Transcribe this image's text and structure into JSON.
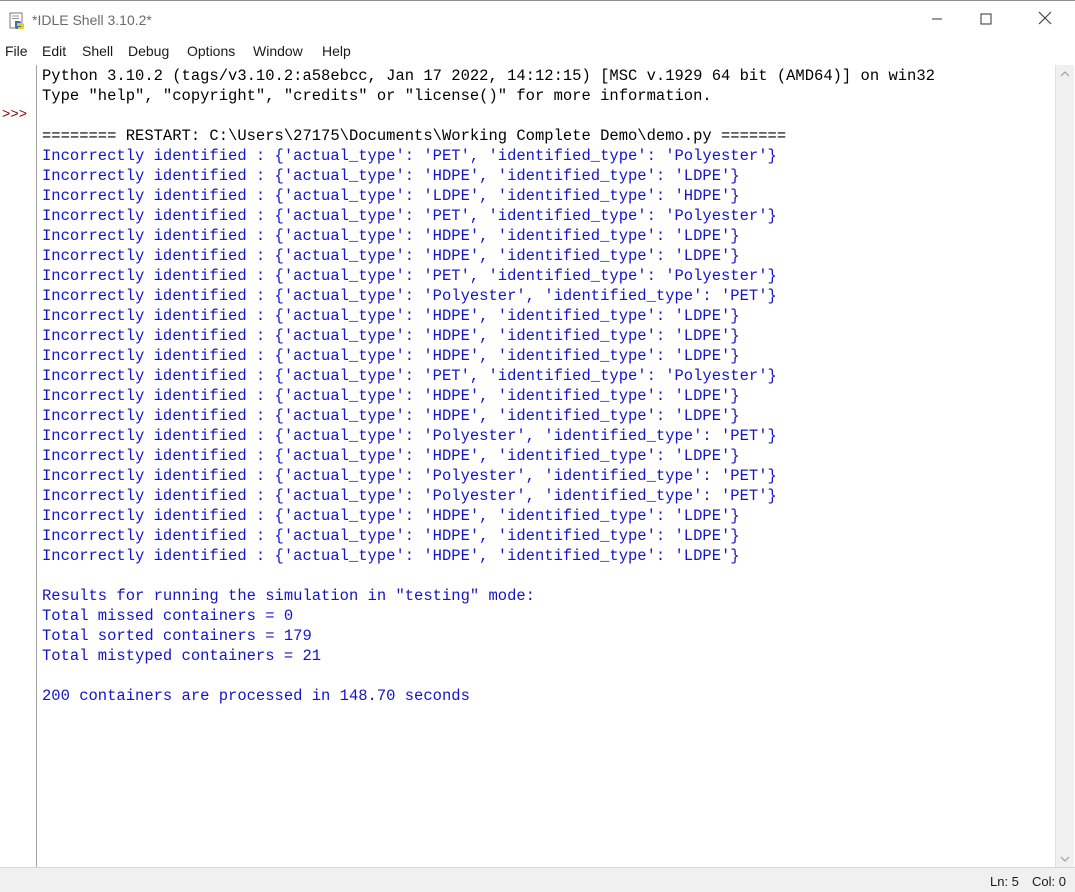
{
  "window": {
    "title": "*IDLE Shell 3.10.2*"
  },
  "menu": {
    "items": [
      {
        "label": "File"
      },
      {
        "label": "Edit"
      },
      {
        "label": "Shell"
      },
      {
        "label": "Debug"
      },
      {
        "label": "Options"
      },
      {
        "label": "Window"
      },
      {
        "label": "Help"
      }
    ]
  },
  "gutter": {
    "prompt": ">>>"
  },
  "shell": {
    "banner_line1": "Python 3.10.2 (tags/v3.10.2:a58ebcc, Jan 17 2022, 14:12:15) [MSC v.1929 64 bit (AMD64)] on win32",
    "banner_line2": "Type \"help\", \"copyright\", \"credits\" or \"license()\" for more information.",
    "restart": "======== RESTART: C:\\Users\\27175\\Documents\\Working Complete Demo\\demo.py =======",
    "output": [
      "Incorrectly identified : {'actual_type': 'PET', 'identified_type': 'Polyester'}",
      "Incorrectly identified : {'actual_type': 'HDPE', 'identified_type': 'LDPE'}",
      "Incorrectly identified : {'actual_type': 'LDPE', 'identified_type': 'HDPE'}",
      "Incorrectly identified : {'actual_type': 'PET', 'identified_type': 'Polyester'}",
      "Incorrectly identified : {'actual_type': 'HDPE', 'identified_type': 'LDPE'}",
      "Incorrectly identified : {'actual_type': 'HDPE', 'identified_type': 'LDPE'}",
      "Incorrectly identified : {'actual_type': 'PET', 'identified_type': 'Polyester'}",
      "Incorrectly identified : {'actual_type': 'Polyester', 'identified_type': 'PET'}",
      "Incorrectly identified : {'actual_type': 'HDPE', 'identified_type': 'LDPE'}",
      "Incorrectly identified : {'actual_type': 'HDPE', 'identified_type': 'LDPE'}",
      "Incorrectly identified : {'actual_type': 'HDPE', 'identified_type': 'LDPE'}",
      "Incorrectly identified : {'actual_type': 'PET', 'identified_type': 'Polyester'}",
      "Incorrectly identified : {'actual_type': 'HDPE', 'identified_type': 'LDPE'}",
      "Incorrectly identified : {'actual_type': 'HDPE', 'identified_type': 'LDPE'}",
      "Incorrectly identified : {'actual_type': 'Polyester', 'identified_type': 'PET'}",
      "Incorrectly identified : {'actual_type': 'HDPE', 'identified_type': 'LDPE'}",
      "Incorrectly identified : {'actual_type': 'Polyester', 'identified_type': 'PET'}",
      "Incorrectly identified : {'actual_type': 'Polyester', 'identified_type': 'PET'}",
      "Incorrectly identified : {'actual_type': 'HDPE', 'identified_type': 'LDPE'}",
      "Incorrectly identified : {'actual_type': 'HDPE', 'identified_type': 'LDPE'}",
      "Incorrectly identified : {'actual_type': 'HDPE', 'identified_type': 'LDPE'}"
    ],
    "results_header": "Results for running the simulation in \"testing\" mode:",
    "missed": "Total missed containers = 0",
    "sorted": "Total sorted containers = 179",
    "mistyped": "Total mistyped containers = 21",
    "summary": "200 containers are processed in 148.70 seconds"
  },
  "status": {
    "line": "Ln: 5",
    "col": "Col: 0"
  },
  "colors": {
    "output_text": "#1414c8",
    "banner_text": "#000000",
    "prompt": "#8b0000"
  },
  "icons": {
    "app": "python-idle-icon",
    "minimize": "minimize-icon",
    "maximize": "maximize-icon",
    "close": "close-icon",
    "scroll_up": "chevron-up-icon",
    "scroll_down": "chevron-down-icon"
  }
}
